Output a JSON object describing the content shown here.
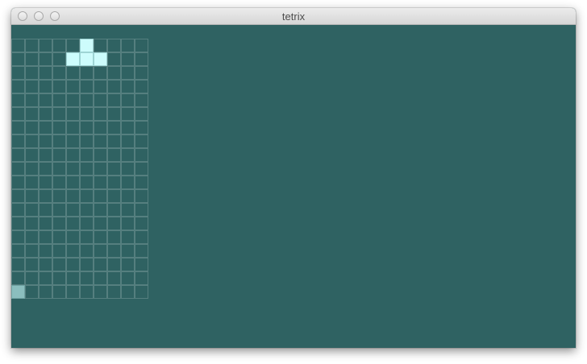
{
  "window": {
    "title": "tetrix",
    "controls": [
      "close-button",
      "minimize-button",
      "zoom-button"
    ]
  },
  "game": {
    "board": {
      "columns": 10,
      "rows": 19
    },
    "active_piece": {
      "shape": "T",
      "cells": [
        [
          5,
          0
        ],
        [
          4,
          1
        ],
        [
          5,
          1
        ],
        [
          6,
          1
        ]
      ]
    },
    "highlighted_cells": [
      [
        0,
        18
      ]
    ],
    "colors": {
      "background": "#2f6262",
      "grid_line": "#557f7f",
      "active_piece": "#cdfcfc",
      "highlight_cell": "#8bbebe"
    }
  }
}
